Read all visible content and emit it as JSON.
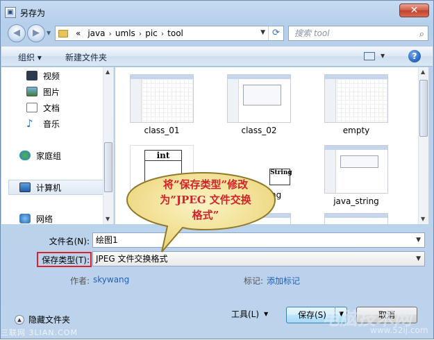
{
  "window": {
    "title": "另存为",
    "close_label": "✕"
  },
  "address": {
    "crumbs": [
      "«",
      "java",
      "umls",
      "pic",
      "tool"
    ],
    "separator": "›"
  },
  "search": {
    "placeholder": "搜索 tool"
  },
  "toolbar": {
    "organize": "组织 ▾",
    "new_folder": "新建文件夹"
  },
  "sidebar": {
    "items": [
      {
        "label": "视频",
        "icon": "video-icon"
      },
      {
        "label": "图片",
        "icon": "pictures-icon"
      },
      {
        "label": "文档",
        "icon": "documents-icon"
      },
      {
        "label": "音乐",
        "icon": "music-icon"
      },
      {
        "label": "家庭组",
        "icon": "homegroup-icon"
      },
      {
        "label": "计算机",
        "icon": "computer-icon"
      },
      {
        "label": "网络",
        "icon": "network-icon"
      }
    ]
  },
  "files": [
    {
      "name": "class_01"
    },
    {
      "name": "class_02"
    },
    {
      "name": "empty"
    },
    {
      "name": "int",
      "partial": true
    },
    {
      "name": "ng",
      "partial": true
    },
    {
      "name": "java_string"
    }
  ],
  "thumb_texts": {
    "int_box": "int",
    "string_box": "String"
  },
  "form": {
    "filename_label": "文件名(N):",
    "filename_value": "绘图1",
    "filetype_label": "保存类型(T):",
    "filetype_value": "JPEG 文件交换格式",
    "author_label": "作者:",
    "author_value": "skywang",
    "tags_label": "标记:",
    "tags_value": "添加标记"
  },
  "buttons": {
    "hide_folders": "隐藏文件夹",
    "tools": "工具(L)",
    "save": "保存(S)",
    "cancel": "取消"
  },
  "callout": {
    "lines": [
      "将”保存类型”修改",
      "为”JPEG 文件交换",
      "格式”"
    ]
  },
  "watermarks": {
    "left": "三联网 3LIAN.COM",
    "big": "电脑技术网",
    "small": "www.52ij.com"
  },
  "colors": {
    "callout_fill": "#f3e59a",
    "callout_text": "#d2232a",
    "highlight_border": "#d9232b",
    "link": "#2060b8"
  }
}
